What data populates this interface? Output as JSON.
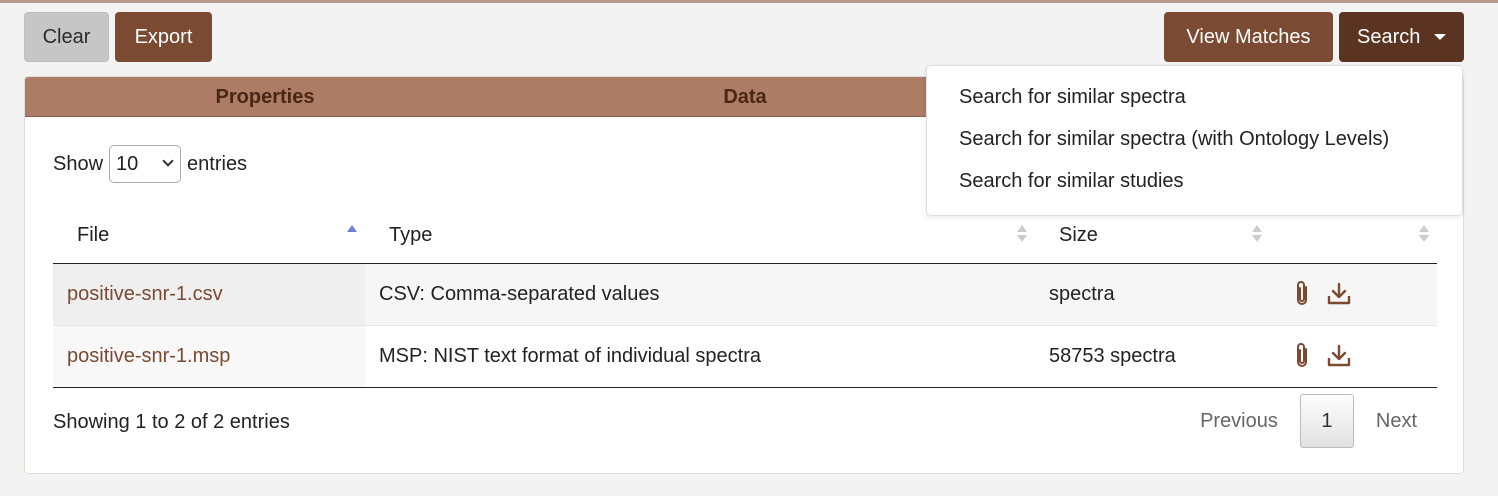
{
  "toolbar": {
    "clear_label": "Clear",
    "export_label": "Export",
    "view_matches_label": "View Matches",
    "search_label": "Search"
  },
  "tabs": [
    {
      "label": "Properties"
    },
    {
      "label": "Data"
    }
  ],
  "length_control": {
    "show_label": "Show",
    "selected": "10",
    "entries_label": "entries"
  },
  "table": {
    "columns": [
      "File",
      "Type",
      "Size",
      ""
    ],
    "sorted_column": "File",
    "sort_direction": "ascending",
    "rows": [
      {
        "file": "positive-snr-1.csv",
        "type": "CSV: Comma-separated values",
        "size": "spectra",
        "actions": [
          "paperclip-icon",
          "download-icon"
        ]
      },
      {
        "file": "positive-snr-1.msp",
        "type": "MSP: NIST text format of individual spectra",
        "size": "58753 spectra",
        "actions": [
          "paperclip-icon",
          "download-icon"
        ]
      }
    ]
  },
  "info_text": "Showing 1 to 2 of 2 entries",
  "pagination": {
    "previous": "Previous",
    "current": "1",
    "next": "Next"
  },
  "search_menu": {
    "items": [
      "Search for similar spectra",
      "Search for similar spectra (with Ontology Levels)",
      "Search for similar studies"
    ]
  },
  "colors": {
    "brand": "#7a4a33",
    "brand_dark": "#5a3321",
    "tab_bar": "#ac7c64",
    "sort_active": "#6f7fd6"
  }
}
